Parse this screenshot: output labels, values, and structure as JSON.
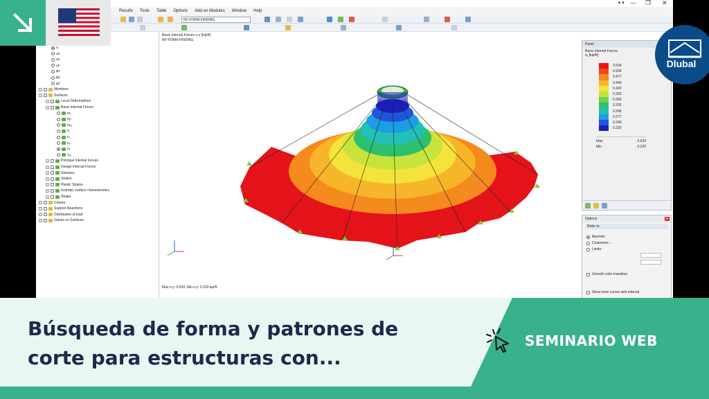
{
  "app": {
    "menus": [
      "Results",
      "Tools",
      "Table",
      "Options",
      "Add-on Modules",
      "Window",
      "Help"
    ],
    "module_combo": "RF-FORM-FINDING",
    "window_controls": [
      "—",
      "❐",
      "✕"
    ]
  },
  "navigator": {
    "items": [
      {
        "label": "u",
        "kind": "radio",
        "on": true
      },
      {
        "label": "ux",
        "kind": "radio"
      },
      {
        "label": "uy",
        "kind": "radio"
      },
      {
        "label": "uz",
        "kind": "radio"
      },
      {
        "label": "φx",
        "kind": "radio"
      },
      {
        "label": "φy",
        "kind": "radio"
      },
      {
        "label": "φz",
        "kind": "radio"
      },
      {
        "label": "Members",
        "kind": "folder"
      },
      {
        "label": "Surfaces",
        "kind": "folder"
      },
      {
        "label": "Local Deformations",
        "kind": "sub"
      },
      {
        "label": "Basic Internal Forces",
        "kind": "sub"
      },
      {
        "label": "m₁",
        "kind": "radio2"
      },
      {
        "label": "mᵧ",
        "kind": "radio2"
      },
      {
        "label": "mₓᵧ",
        "kind": "radio2"
      },
      {
        "label": "vₓ",
        "kind": "radio2"
      },
      {
        "label": "vᵧ",
        "kind": "radio2"
      },
      {
        "label": "nₓ",
        "kind": "radio2"
      },
      {
        "label": "nᵧ",
        "kind": "radio2",
        "on": true
      },
      {
        "label": "nₓᵧ",
        "kind": "radio2"
      },
      {
        "label": "Principal Internal Forces",
        "kind": "sub"
      },
      {
        "label": "Design Internal Forces",
        "kind": "sub"
      },
      {
        "label": "Stresses",
        "kind": "sub"
      },
      {
        "label": "Strains",
        "kind": "sub"
      },
      {
        "label": "Plastic Strains",
        "kind": "sub"
      },
      {
        "label": "Isotropic surface characteristics",
        "kind": "sub"
      },
      {
        "label": "Shape",
        "kind": "sub"
      },
      {
        "label": "Criteria",
        "kind": "folder"
      },
      {
        "label": "Support Reactions",
        "kind": "folder"
      },
      {
        "label": "Distribution of load",
        "kind": "folder"
      },
      {
        "label": "Values on Surfaces",
        "kind": "folder"
      }
    ]
  },
  "view": {
    "header_line1": "Basic Internal Forces n-y [kip/ft]",
    "header_line2": "RF-FORM-FINDING",
    "footer": "Max n-y: 0.534, Min n-y: 0.220 kip/ft"
  },
  "panel": {
    "title": "Panel",
    "subtitle": "Basic Internal Forces",
    "unit": "nᵧ [kip/ft]",
    "legend": [
      {
        "value": "0.534",
        "color": "#e8141a"
      },
      {
        "value": "0.506",
        "color": "#f04a10"
      },
      {
        "value": "0.477",
        "color": "#f58a1e"
      },
      {
        "value": "0.449",
        "color": "#f7b52a"
      },
      {
        "value": "0.420",
        "color": "#f3e33b"
      },
      {
        "value": "0.392",
        "color": "#c6e43c"
      },
      {
        "value": "0.363",
        "color": "#6fd04a"
      },
      {
        "value": "0.335",
        "color": "#2dc06f"
      },
      {
        "value": "0.306",
        "color": "#23c0b6"
      },
      {
        "value": "0.277",
        "color": "#1b9fe2"
      },
      {
        "value": "0.249",
        "color": "#1f56d8"
      },
      {
        "value": "0.220",
        "color": "#1a1fb8"
      }
    ],
    "max_label": "Max",
    "max_value": "0.534",
    "min_label": "Min",
    "min_value": "0.220"
  },
  "options": {
    "title": "Options",
    "group": "Refer to",
    "maxmin": "Max/min",
    "customize": "Customize...",
    "limits": "Limits:",
    "smooth": "Smooth color transition",
    "levels": "Show level curves with interval"
  },
  "banner": {
    "title_line1": "Búsqueda de forma y patrones de",
    "title_line2": "corte para estructuras con...",
    "tag": "SEMINARIO WEB",
    "brand": "Dlubal"
  },
  "colors": {
    "accent": "#3ab18d",
    "brand_blue": "#0a4b88",
    "title_text": "#1c2a4a"
  }
}
